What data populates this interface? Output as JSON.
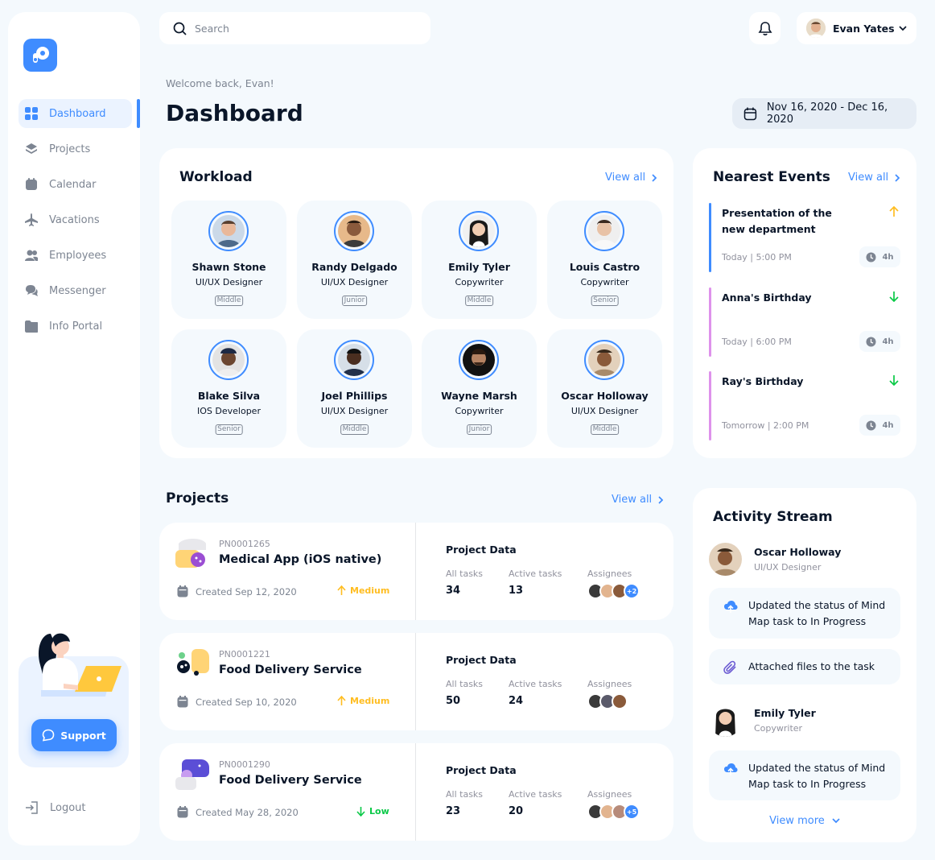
{
  "sidebar": {
    "items": [
      {
        "label": "Dashboard",
        "icon": "dashboard-icon",
        "active": true
      },
      {
        "label": "Projects",
        "icon": "layers-icon"
      },
      {
        "label": "Calendar",
        "icon": "calendar-icon"
      },
      {
        "label": "Vacations",
        "icon": "airplane-icon"
      },
      {
        "label": "Employees",
        "icon": "users-icon"
      },
      {
        "label": "Messenger",
        "icon": "chat-icon"
      },
      {
        "label": "Info Portal",
        "icon": "folder-icon"
      }
    ],
    "support_label": "Support",
    "logout_label": "Logout"
  },
  "search": {
    "placeholder": "Search"
  },
  "user": {
    "name": "Evan Yates"
  },
  "header": {
    "welcome": "Welcome back, Evan!",
    "title": "Dashboard",
    "date_range": "Nov 16, 2020 - Dec 16, 2020"
  },
  "workload": {
    "title": "Workload",
    "view_all": "View all",
    "employees": [
      {
        "name": "Shawn Stone",
        "role": "UI/UX Designer",
        "level": "Middle"
      },
      {
        "name": "Randy Delgado",
        "role": "UI/UX Designer",
        "level": "Junior"
      },
      {
        "name": "Emily Tyler",
        "role": "Copywriter",
        "level": "Middle"
      },
      {
        "name": "Louis Castro",
        "role": "Copywriter",
        "level": "Senior"
      },
      {
        "name": "Blake Silva",
        "role": "IOS Developer",
        "level": "Senior"
      },
      {
        "name": "Joel Phillips",
        "role": "UI/UX Designer",
        "level": "Middle"
      },
      {
        "name": "Wayne Marsh",
        "role": "Copywriter",
        "level": "Junior"
      },
      {
        "name": "Oscar Holloway",
        "role": "UI/UX Designer",
        "level": "Middle"
      }
    ]
  },
  "events": {
    "title": "Nearest Events",
    "view_all": "View all",
    "items": [
      {
        "title": "Presentation of the new department",
        "when": "Today | 5:00 PM",
        "duration": "4h",
        "color": "#3f8cff",
        "direction": "up",
        "arrow_color": "#ffbd21"
      },
      {
        "title": "Anna's Birthday",
        "when": "Today | 6:00 PM",
        "duration": "4h",
        "color": "#de92eb",
        "direction": "down",
        "arrow_color": "#0ac947"
      },
      {
        "title": "Ray's Birthday",
        "when": "Tomorrow | 2:00 PM",
        "duration": "4h",
        "color": "#de92eb",
        "direction": "down",
        "arrow_color": "#0ac947"
      }
    ]
  },
  "projects": {
    "title": "Projects",
    "view_all": "View all",
    "items": [
      {
        "number": "PN0001265",
        "name": "Medical App (iOS native)",
        "created": "Created Sep 12, 2020",
        "priority": "Medium",
        "priority_color": "#ffbd21",
        "data_title": "Project Data",
        "all_tasks_label": "All tasks",
        "all_tasks": "34",
        "active_tasks_label": "Active tasks",
        "active_tasks": "13",
        "assignees_label": "Assignees",
        "extra": "+2"
      },
      {
        "number": "PN0001221",
        "name": "Food Delivery Service",
        "created": "Created Sep 10, 2020",
        "priority": "Medium",
        "priority_color": "#ffbd21",
        "data_title": "Project Data",
        "all_tasks_label": "All tasks",
        "all_tasks": "50",
        "active_tasks_label": "Active tasks",
        "active_tasks": "24",
        "assignees_label": "Assignees",
        "extra": ""
      },
      {
        "number": "PN0001290",
        "name": "Food Delivery Service",
        "created": "Created May 28, 2020",
        "priority": "Low",
        "priority_color": "#0ac947",
        "data_title": "Project Data",
        "all_tasks_label": "All tasks",
        "all_tasks": "23",
        "active_tasks_label": "Active tasks",
        "active_tasks": "20",
        "assignees_label": "Assignees",
        "extra": "+5"
      }
    ]
  },
  "activity": {
    "title": "Activity Stream",
    "users": [
      {
        "name": "Oscar Holloway",
        "role": "UI/UX Designer"
      },
      {
        "name": "Emily Tyler",
        "role": "Copywriter"
      }
    ],
    "items": [
      {
        "text": "Updated the status of Mind Map task to In Progress",
        "icon": "upload-cloud-icon"
      },
      {
        "text": "Attached files to the task",
        "icon": "paperclip-icon"
      },
      {
        "text": "Updated the status of Mind Map task to In Progress",
        "icon": "upload-cloud-icon"
      }
    ],
    "view_more": "View more"
  },
  "colors": {
    "accent": "#3f8cff",
    "background": "#f4f9fd",
    "text": "#0a1629",
    "muted": "#7d8592"
  }
}
